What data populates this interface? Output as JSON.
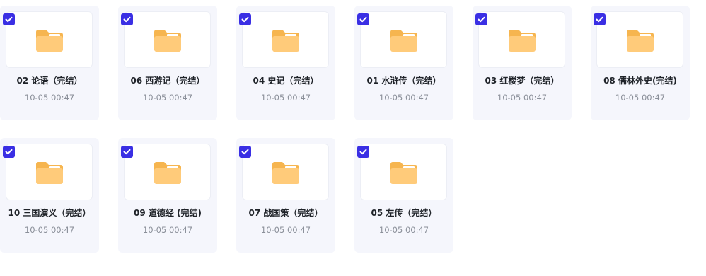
{
  "colors": {
    "checkbox": "#3a2fe4",
    "folder_back": "#f6b54f",
    "folder_front": "#ffcb7a",
    "card_bg": "#f5f6fc"
  },
  "icons": {
    "checkbox": "check-icon",
    "folder": "folder-icon"
  },
  "files": [
    {
      "name": "02 论语（完结）",
      "time": "10-05 00:47",
      "checked": true
    },
    {
      "name": "06 西游记（完结）",
      "time": "10-05 00:47",
      "checked": true
    },
    {
      "name": "04 史记（完结）",
      "time": "10-05 00:47",
      "checked": true
    },
    {
      "name": "01 水浒传（完结）",
      "time": "10-05 00:47",
      "checked": true
    },
    {
      "name": "03 红楼梦（完结）",
      "time": "10-05 00:47",
      "checked": true
    },
    {
      "name": "08 儒林外史(完结)",
      "time": "10-05 00:47",
      "checked": true
    },
    {
      "name": "10 三国演义（完结）",
      "time": "10-05 00:47",
      "checked": true
    },
    {
      "name": "09 道德经 (完结)",
      "time": "10-05 00:47",
      "checked": true
    },
    {
      "name": "07 战国策（完结）",
      "time": "10-05 00:47",
      "checked": true
    },
    {
      "name": "05 左传（完结）",
      "time": "10-05 00:47",
      "checked": true
    }
  ]
}
